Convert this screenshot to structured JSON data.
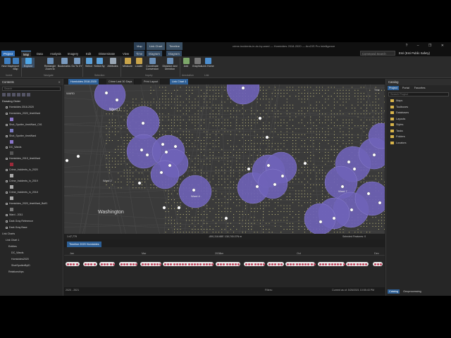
{
  "titlebar": {
    "title": "crime-incidents-in-dc-by-ward — Homicides 2018-2020 — ArcGIS Pro Intelligence",
    "context_tabs": [
      {
        "group": "Map",
        "tab": "Time"
      },
      {
        "group": "Link Chart",
        "tab": "Diagram"
      },
      {
        "group": "Timeline",
        "tab": "Diagram"
      }
    ],
    "window_buttons": "? – ❐ ✕"
  },
  "ribbon_tabs": [
    "Project",
    "Map",
    "Data",
    "Analysis",
    "Imagery",
    "Edit",
    "Disseminate",
    "View",
    "Time",
    "Diagram",
    "Diagram"
  ],
  "ribbon_search_placeholder": "Command Search (Alt+Q)",
  "user_label": "Esri (Esri Public Safety)",
  "ribbon": {
    "buttons": [
      "New Map",
      "Import Map",
      "Explore",
      "Rectangle Zoom to",
      "Bookmarks",
      "Go To XY",
      "Select",
      "Select By",
      "Attributes",
      "Measure",
      "Locate",
      "Coordinate Conversion",
      "Distance and Direction",
      "Add",
      "Graphics",
      "Link Home"
    ],
    "groups": [
      "Invest",
      "Navigate",
      "Selection",
      "Inquiry",
      "Annotation",
      "Link"
    ]
  },
  "contents": {
    "title": "Contents",
    "search_placeholder": "Search",
    "drawing_order": "Drawing Order",
    "items": [
      {
        "label": "Homicides 2018-2020",
        "sym": ""
      },
      {
        "label": "Homicides_2020_timeWard",
        "sym": "#8a76c9"
      },
      {
        "label": "Shot_Spotter_timeWard_Cit1",
        "sym": "#7a7ac0"
      },
      {
        "label": "Shot_Spotter_timeWard",
        "sym": "#8a76c9"
      },
      {
        "label": "DC_Wards",
        "sym": "#555555"
      },
      {
        "label": "Homicides_2019_timeWard",
        "sym": "#9c2a3a"
      },
      {
        "label": "Crime_Incidents_in_2020",
        "sym": "#aaaaaa"
      },
      {
        "label": "Crime_Incidents_in_2019",
        "sym": "#aaaaaa"
      },
      {
        "label": "Crime_Incidents_in_2018",
        "sym": "#aaaaaa"
      },
      {
        "label": "Homicides_2020_timeWard_Buff1",
        "sym": "#777777"
      },
      {
        "label": "Ward - 2011",
        "sym": ""
      },
      {
        "label": "Dark Gray Reference",
        "sym": ""
      },
      {
        "label": "Dark Gray Base",
        "sym": ""
      }
    ],
    "link_charts_header": "Link Charts",
    "link_chart": "Link Chart 1",
    "link_entities": "Entities",
    "link_items": [
      "DC_Wards",
      "Homicides2020",
      "ShotSpotterByID",
      "Relationships"
    ]
  },
  "map_tabs": [
    "Homicides 2018-2020",
    "Crime Last 30 Days",
    "Print Layout",
    "Link Chart 1"
  ],
  "map": {
    "labels": [
      "Ward 1",
      "Ward 2",
      "Ward 3",
      "Ward 4",
      "Ward 5",
      "Ward 6",
      "Ward 7",
      "Ward 8",
      "Washington",
      "WARD"
    ],
    "scale": "1:47,779",
    "coords": "-890,316.88E 138,745.07N m",
    "selected": "Selected Features: 0",
    "time_label": "Time"
  },
  "timeline": {
    "tab": "Timeline 2020 Homicides",
    "year": "2020",
    "months": [
      "Jan",
      "Feb",
      "Mar",
      "Apr",
      "May",
      "Jun",
      "Jul",
      "Aug",
      "Sep",
      "Oct",
      "Nov",
      "Dec"
    ]
  },
  "catalog": {
    "title": "Catalog",
    "tabs": [
      "Project",
      "Portal",
      "Favorites"
    ],
    "search_placeholder": "Search Project",
    "items": [
      "Maps",
      "Toolboxes",
      "Databases",
      "Layouts",
      "Styles",
      "Tasks",
      "Folders",
      "Locators"
    ],
    "bottom_tabs": [
      "Catalog",
      "Geoprocessing"
    ]
  },
  "statusbar": {
    "left": "2020 - 2021",
    "filters": "Filters:",
    "current": "Current as of: 5/26/2021 10:55:43 PM"
  },
  "colors": {
    "ribbon_accent": "#2f6db5",
    "buffer_fill": "#6f63b8",
    "incident_dot": "#d9d38a",
    "timeline_event": "#c2435c"
  }
}
